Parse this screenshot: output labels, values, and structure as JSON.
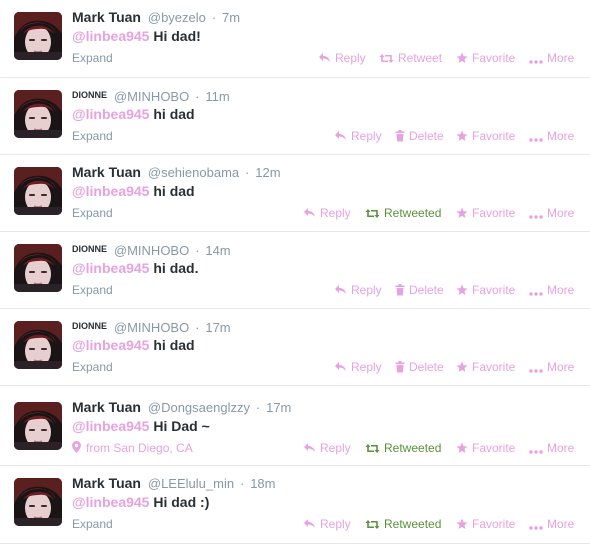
{
  "colors": {
    "accent": "#e7a2e0",
    "muted": "#8899a6",
    "retweeted": "#5c913b",
    "text": "#292f33"
  },
  "tweets": [
    {
      "name": "Mark Tuan",
      "handle": "@byezelo",
      "time": "7m",
      "mention": "@linbea945",
      "text": "Hi dad!",
      "meta": "Expand",
      "actions": [
        "Reply",
        "Retweet",
        "Favorite",
        "More"
      ],
      "small_name": false
    },
    {
      "name": "DIONNE",
      "handle": "@MINHOBO",
      "time": "11m",
      "mention": "@linbea945",
      "text": "hi dad",
      "meta": "Expand",
      "actions": [
        "Reply",
        "Delete",
        "Favorite",
        "More"
      ],
      "small_name": true
    },
    {
      "name": "Mark Tuan",
      "handle": "@sehienobama",
      "time": "12m",
      "mention": "@linbea945",
      "text": "hi dad",
      "meta": "Expand",
      "actions": [
        "Reply",
        "Retweeted",
        "Favorite",
        "More"
      ],
      "small_name": false
    },
    {
      "name": "DIONNE",
      "handle": "@MINHOBO",
      "time": "14m",
      "mention": "@linbea945",
      "text": "hi dad.",
      "meta": "Expand",
      "actions": [
        "Reply",
        "Delete",
        "Favorite",
        "More"
      ],
      "small_name": true
    },
    {
      "name": "DIONNE",
      "handle": "@MINHOBO",
      "time": "17m",
      "mention": "@linbea945",
      "text": "hi dad",
      "meta": "Expand",
      "actions": [
        "Reply",
        "Delete",
        "Favorite",
        "More"
      ],
      "small_name": true
    },
    {
      "name": "Mark Tuan",
      "handle": "@Dongsaenglzzy",
      "time": "17m",
      "mention": "@linbea945",
      "text": "Hi Dad ~",
      "meta": "from San Diego, CA",
      "actions": [
        "Reply",
        "Retweeted",
        "Favorite",
        "More"
      ],
      "small_name": false
    },
    {
      "name": "Mark Tuan",
      "handle": "@LEElulu_min",
      "time": "18m",
      "mention": "@linbea945",
      "text": "Hi dad :)",
      "meta": "Expand",
      "actions": [
        "Reply",
        "Retweeted",
        "Favorite",
        "More"
      ],
      "small_name": false
    }
  ]
}
